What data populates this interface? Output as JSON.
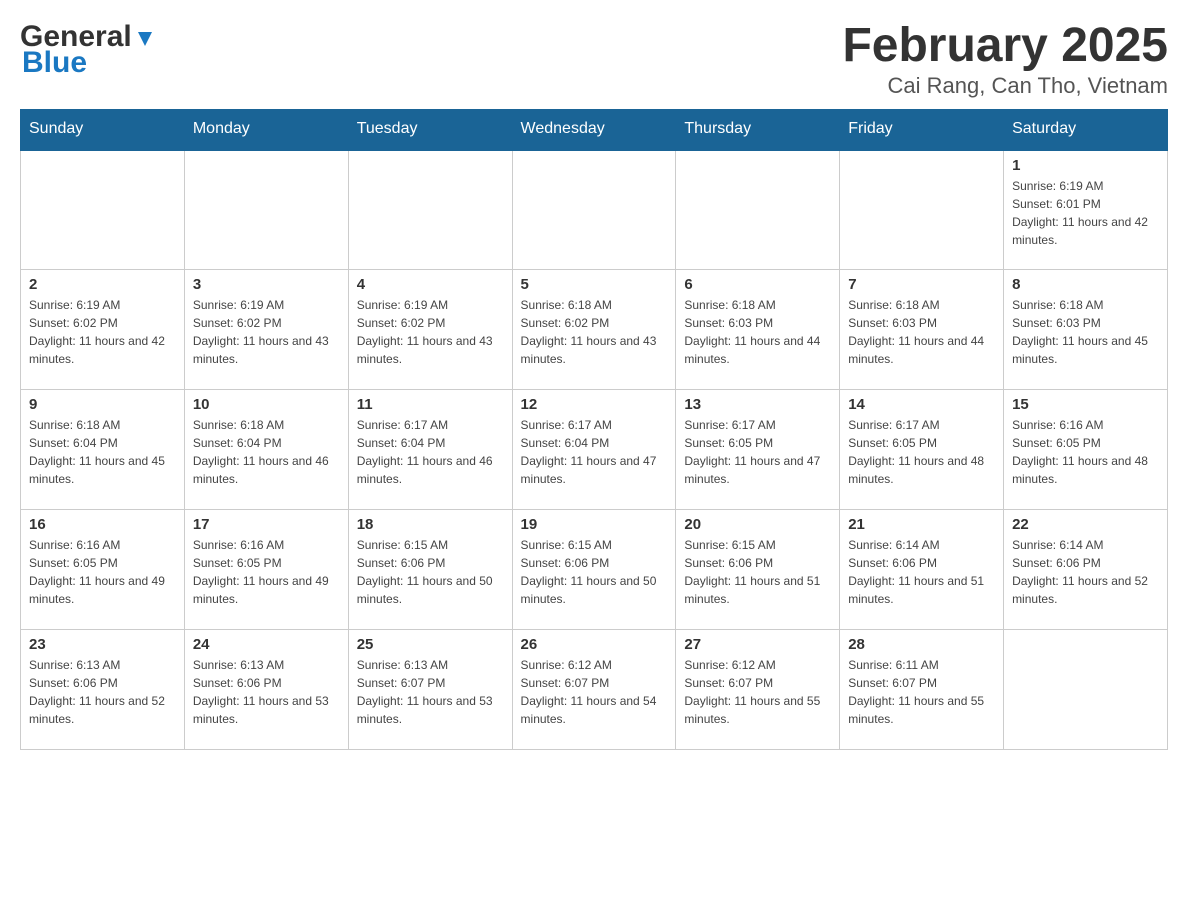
{
  "header": {
    "logo_text_general": "General",
    "logo_text_blue": "Blue",
    "title": "February 2025",
    "subtitle": "Cai Rang, Can Tho, Vietnam"
  },
  "weekdays": [
    "Sunday",
    "Monday",
    "Tuesday",
    "Wednesday",
    "Thursday",
    "Friday",
    "Saturday"
  ],
  "weeks": [
    [
      {
        "day": "",
        "info": ""
      },
      {
        "day": "",
        "info": ""
      },
      {
        "day": "",
        "info": ""
      },
      {
        "day": "",
        "info": ""
      },
      {
        "day": "",
        "info": ""
      },
      {
        "day": "",
        "info": ""
      },
      {
        "day": "1",
        "info": "Sunrise: 6:19 AM\nSunset: 6:01 PM\nDaylight: 11 hours and 42 minutes."
      }
    ],
    [
      {
        "day": "2",
        "info": "Sunrise: 6:19 AM\nSunset: 6:02 PM\nDaylight: 11 hours and 42 minutes."
      },
      {
        "day": "3",
        "info": "Sunrise: 6:19 AM\nSunset: 6:02 PM\nDaylight: 11 hours and 43 minutes."
      },
      {
        "day": "4",
        "info": "Sunrise: 6:19 AM\nSunset: 6:02 PM\nDaylight: 11 hours and 43 minutes."
      },
      {
        "day": "5",
        "info": "Sunrise: 6:18 AM\nSunset: 6:02 PM\nDaylight: 11 hours and 43 minutes."
      },
      {
        "day": "6",
        "info": "Sunrise: 6:18 AM\nSunset: 6:03 PM\nDaylight: 11 hours and 44 minutes."
      },
      {
        "day": "7",
        "info": "Sunrise: 6:18 AM\nSunset: 6:03 PM\nDaylight: 11 hours and 44 minutes."
      },
      {
        "day": "8",
        "info": "Sunrise: 6:18 AM\nSunset: 6:03 PM\nDaylight: 11 hours and 45 minutes."
      }
    ],
    [
      {
        "day": "9",
        "info": "Sunrise: 6:18 AM\nSunset: 6:04 PM\nDaylight: 11 hours and 45 minutes."
      },
      {
        "day": "10",
        "info": "Sunrise: 6:18 AM\nSunset: 6:04 PM\nDaylight: 11 hours and 46 minutes."
      },
      {
        "day": "11",
        "info": "Sunrise: 6:17 AM\nSunset: 6:04 PM\nDaylight: 11 hours and 46 minutes."
      },
      {
        "day": "12",
        "info": "Sunrise: 6:17 AM\nSunset: 6:04 PM\nDaylight: 11 hours and 47 minutes."
      },
      {
        "day": "13",
        "info": "Sunrise: 6:17 AM\nSunset: 6:05 PM\nDaylight: 11 hours and 47 minutes."
      },
      {
        "day": "14",
        "info": "Sunrise: 6:17 AM\nSunset: 6:05 PM\nDaylight: 11 hours and 48 minutes."
      },
      {
        "day": "15",
        "info": "Sunrise: 6:16 AM\nSunset: 6:05 PM\nDaylight: 11 hours and 48 minutes."
      }
    ],
    [
      {
        "day": "16",
        "info": "Sunrise: 6:16 AM\nSunset: 6:05 PM\nDaylight: 11 hours and 49 minutes."
      },
      {
        "day": "17",
        "info": "Sunrise: 6:16 AM\nSunset: 6:05 PM\nDaylight: 11 hours and 49 minutes."
      },
      {
        "day": "18",
        "info": "Sunrise: 6:15 AM\nSunset: 6:06 PM\nDaylight: 11 hours and 50 minutes."
      },
      {
        "day": "19",
        "info": "Sunrise: 6:15 AM\nSunset: 6:06 PM\nDaylight: 11 hours and 50 minutes."
      },
      {
        "day": "20",
        "info": "Sunrise: 6:15 AM\nSunset: 6:06 PM\nDaylight: 11 hours and 51 minutes."
      },
      {
        "day": "21",
        "info": "Sunrise: 6:14 AM\nSunset: 6:06 PM\nDaylight: 11 hours and 51 minutes."
      },
      {
        "day": "22",
        "info": "Sunrise: 6:14 AM\nSunset: 6:06 PM\nDaylight: 11 hours and 52 minutes."
      }
    ],
    [
      {
        "day": "23",
        "info": "Sunrise: 6:13 AM\nSunset: 6:06 PM\nDaylight: 11 hours and 52 minutes."
      },
      {
        "day": "24",
        "info": "Sunrise: 6:13 AM\nSunset: 6:06 PM\nDaylight: 11 hours and 53 minutes."
      },
      {
        "day": "25",
        "info": "Sunrise: 6:13 AM\nSunset: 6:07 PM\nDaylight: 11 hours and 53 minutes."
      },
      {
        "day": "26",
        "info": "Sunrise: 6:12 AM\nSunset: 6:07 PM\nDaylight: 11 hours and 54 minutes."
      },
      {
        "day": "27",
        "info": "Sunrise: 6:12 AM\nSunset: 6:07 PM\nDaylight: 11 hours and 55 minutes."
      },
      {
        "day": "28",
        "info": "Sunrise: 6:11 AM\nSunset: 6:07 PM\nDaylight: 11 hours and 55 minutes."
      },
      {
        "day": "",
        "info": ""
      }
    ]
  ]
}
